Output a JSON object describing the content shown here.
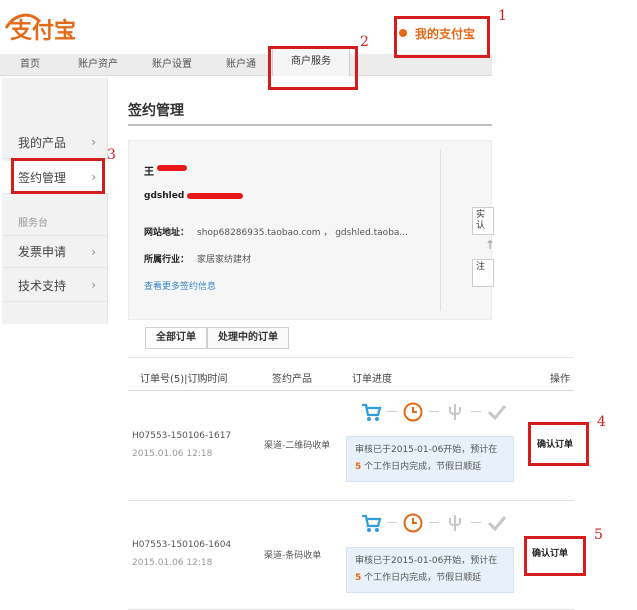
{
  "header": {
    "logo_text": "支付宝",
    "my_alipay": "我的支付宝"
  },
  "nav": {
    "items": [
      "首页",
      "账户资产",
      "账户设置",
      "账户通",
      "商户服务"
    ]
  },
  "sidebar": {
    "items": [
      {
        "label": "我的产品"
      },
      {
        "label": "签约管理"
      },
      {
        "label": "发票申请"
      },
      {
        "label": "技术支持"
      }
    ],
    "caption": "服务台"
  },
  "page": {
    "title": "签约管理"
  },
  "info": {
    "name_prefix": "王",
    "email": "gdshled",
    "website_label": "网站地址：",
    "website_value": "shop68286935.taobao.com ， gdshled.taoba...",
    "industry_label": "所属行业：",
    "industry_value": "家居家纺建材",
    "more_link": "查看更多签约信息",
    "side_btn_1": "实 认",
    "side_btn_2": "注"
  },
  "tabs": {
    "all": "全部订单",
    "processing": "处理中的订单"
  },
  "table": {
    "headers": {
      "order": "订单号(5)|订购时间",
      "product": "签约产品",
      "progress": "订单进度",
      "action": "操作"
    },
    "rows": [
      {
        "order_no": "H07553-150106-1617",
        "date": "2015.01.06 12:18",
        "product": "渠道-二维码收单",
        "msg_line1": "审核已于2015-01-06开始，预计在",
        "msg_days": "5",
        "msg_line2": "个工作日内完成，节假日顺延",
        "action": "确认订单"
      },
      {
        "order_no": "H07553-150106-1604",
        "date": "2015.01.06 12:18",
        "product": "渠道-条码收单",
        "msg_line1": "审核已于2015-01-06开始，预计在",
        "msg_days": "5",
        "msg_line2": "个工作日内完成，节假日顺延",
        "action": "确认订单"
      }
    ]
  },
  "annotations": [
    "1",
    "2",
    "3",
    "4",
    "5"
  ],
  "colors": {
    "accent": "#e46a17",
    "annotation": "#d41e1e",
    "link": "#3a85c6",
    "cart": "#2f9ee0"
  }
}
